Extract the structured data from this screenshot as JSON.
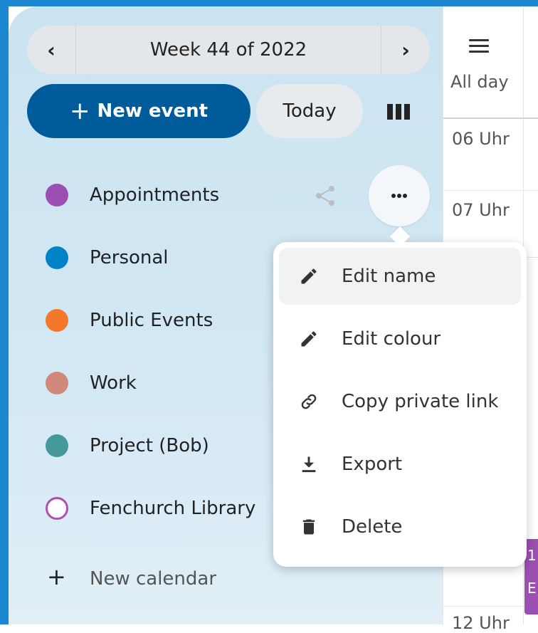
{
  "navigation": {
    "week_label": "Week 44 of 2022",
    "prev_label": "‹",
    "next_label": "›"
  },
  "actions": {
    "new_event_icon": "+",
    "new_event_label": "New event",
    "today_label": "Today"
  },
  "calendars": [
    {
      "name": "Appointments",
      "color": "#9b4fb3",
      "hollow": false
    },
    {
      "name": "Personal",
      "color": "#0082c9",
      "hollow": false
    },
    {
      "name": "Public Events",
      "color": "#f4772a",
      "hollow": false
    },
    {
      "name": "Work",
      "color": "#d08878",
      "hollow": false
    },
    {
      "name": "Project (Bob)",
      "color": "#45999b",
      "hollow": false
    },
    {
      "name": "Fenchurch Library",
      "color": "#b04fae",
      "hollow": true
    }
  ],
  "new_calendar": {
    "icon": "+",
    "label": "New calendar"
  },
  "menu": {
    "items": [
      {
        "label": "Edit name",
        "icon": "pencil-icon"
      },
      {
        "label": "Edit colour",
        "icon": "pencil-icon"
      },
      {
        "label": "Copy private link",
        "icon": "link-icon"
      },
      {
        "label": "Export",
        "icon": "download-icon"
      },
      {
        "label": "Delete",
        "icon": "trash-icon"
      }
    ]
  },
  "grid": {
    "allday_label": "All day",
    "hours": [
      "06 Uhr",
      "07 Uhr",
      "12 Uhr"
    ],
    "event_chip_lines": [
      "1",
      "E"
    ]
  },
  "colors": {
    "accent": "#005b9a",
    "frame": "#1a87d0",
    "sidebar_bg": "#cbe3f1"
  }
}
